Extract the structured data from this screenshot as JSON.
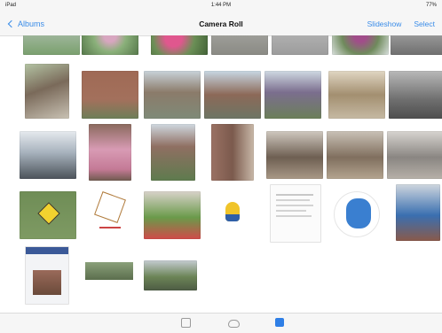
{
  "status_bar": {
    "left": "iPad",
    "time": "1:44 PM",
    "right": "77%"
  },
  "nav": {
    "back_label": "Albums",
    "title": "Camera Roll",
    "right_1": "Slideshow",
    "right_2": "Select"
  },
  "tabs": [
    {
      "name": "photos",
      "icon": "photos-square-icon",
      "active": false
    },
    {
      "name": "shared",
      "icon": "cloud-icon",
      "active": false
    },
    {
      "name": "albums",
      "icon": "albums-filled-icon",
      "active": true
    }
  ],
  "colors": {
    "accent": "#3a8ce8",
    "active_tab": "#2f7fe6"
  }
}
